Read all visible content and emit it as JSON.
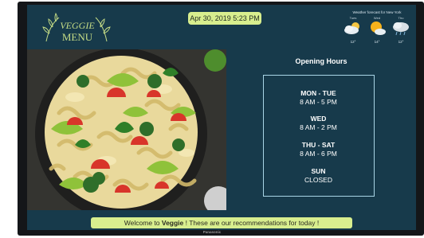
{
  "logo": {
    "line1": "VEGGIE",
    "line2": "MENU"
  },
  "header": {
    "datetime": "Apr 30, 2019 5:23 PM"
  },
  "weather": {
    "title": "Weather forecast for New York",
    "days": [
      {
        "name": "Tues",
        "icon": "cloud-sun-icon",
        "temp": "12°"
      },
      {
        "name": "Wed",
        "icon": "sun-cloud-icon",
        "temp": "14°"
      },
      {
        "name": "Thu",
        "icon": "rain-cloud-icon",
        "temp": "12°"
      }
    ]
  },
  "hours": {
    "title": "Opening Hours",
    "rows": [
      {
        "day": "MON - TUE",
        "time": "8 AM - 5 PM"
      },
      {
        "day": "WED",
        "time": "8 AM - 2 PM"
      },
      {
        "day": "THU - SAT",
        "time": "8 AM - 6 PM"
      },
      {
        "day": "SUN",
        "time": "CLOSED"
      }
    ]
  },
  "footer": {
    "prefix": "Welcome to ",
    "brand": "Veggie",
    "suffix": " ! These are our recommendations for today !"
  },
  "monitor": {
    "brand": "Panasonic"
  },
  "colors": {
    "background": "#173a4b",
    "accent": "#d8ee8e",
    "box_border": "#a9d5e6"
  }
}
